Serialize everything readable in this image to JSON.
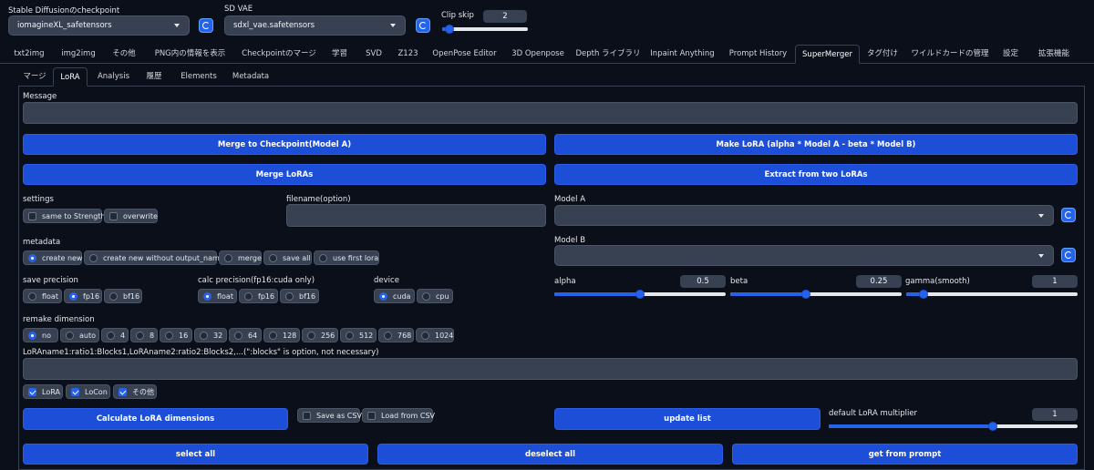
{
  "top": {
    "checkpoint_label": "Stable Diffusionのcheckpoint",
    "checkpoint_value": "iomagineXL_safetensors",
    "vae_label": "SD VAE",
    "vae_value": "sdxl_vae.safetensors",
    "clip_skip_label": "Clip skip",
    "clip_skip_value": "2",
    "clip_skip_fraction": 0.08
  },
  "tabs": [
    "txt2img",
    "img2img",
    "その他",
    "PNG内の情報を表示",
    "Checkpointのマージ",
    "学習",
    "SVD",
    "Z123",
    "OpenPose Editor",
    "3D Openpose",
    "Depth ライブラリ",
    "Inpaint Anything",
    "Prompt History",
    "SuperMerger",
    "タグ付け",
    "ワイルドカードの管理",
    "設定",
    "拡張機能"
  ],
  "selected_tab": "SuperMerger",
  "subtabs": [
    "マージ",
    "LoRA",
    "Analysis",
    "履歴",
    "Elements",
    "Metadata"
  ],
  "selected_subtab": "LoRA",
  "message_label": "Message",
  "buttons": {
    "merge_to_checkpoint": "Merge to Checkpoint(Model A)",
    "make_lora": "Make LoRA (alpha * Model A - beta * Model B)",
    "merge_loras": "Merge LoRAs",
    "extract": "Extract from two LoRAs",
    "calc_dims": "Calculate LoRA dimensions",
    "update_list": "update list",
    "select_all": "select all",
    "deselect_all": "deselect all",
    "get_from_prompt": "get from prompt"
  },
  "settings": {
    "label": "settings",
    "same_to_strength": "same to Strength",
    "overwrite": "overwrite",
    "filename_label": "filename(option)"
  },
  "model_a_label": "Model A",
  "model_b_label": "Model B",
  "metadata": {
    "label": "metadata",
    "options": [
      "create new",
      "create new without output_name",
      "merge",
      "save all",
      "use first lora"
    ],
    "selected": "create new"
  },
  "save_precision": {
    "label": "save precision",
    "options": [
      "float",
      "fp16",
      "bf16"
    ],
    "selected": "fp16"
  },
  "calc_precision": {
    "label": "calc precision(fp16:cuda only)",
    "options": [
      "float",
      "fp16",
      "bf16"
    ],
    "selected": "float"
  },
  "device": {
    "label": "device",
    "options": [
      "cuda",
      "cpu"
    ],
    "selected": "cuda"
  },
  "sliders": {
    "alpha": {
      "label": "alpha",
      "value": "0.5",
      "fraction": 0.5
    },
    "beta": {
      "label": "beta",
      "value": "0.25",
      "fraction": 0.44
    },
    "gamma": {
      "label": "gamma(smooth)",
      "value": "1",
      "fraction": 0.1
    },
    "default_mult": {
      "label": "default LoRA multiplier",
      "value": "1",
      "fraction": 0.66
    }
  },
  "remake": {
    "label": "remake dimension",
    "options": [
      "no",
      "auto",
      "4",
      "8",
      "16",
      "32",
      "64",
      "128",
      "256",
      "512",
      "768",
      "1024"
    ],
    "selected": "no"
  },
  "lora_ratio_label": "LoRAname1:ratio1:Blocks1,LoRAname2:ratio2:Blocks2,...(\":blocks\" is option, not necessary)",
  "types": [
    {
      "label": "LoRA",
      "checked": true
    },
    {
      "label": "LoCon",
      "checked": true
    },
    {
      "label": "その他",
      "checked": true
    }
  ],
  "csv": {
    "save": "Save as CSV",
    "load": "Load from CSV"
  },
  "colors": {
    "background": "#0b0f19",
    "accent": "#2563eb",
    "button": "#1d4ed8",
    "field": "#374151"
  }
}
